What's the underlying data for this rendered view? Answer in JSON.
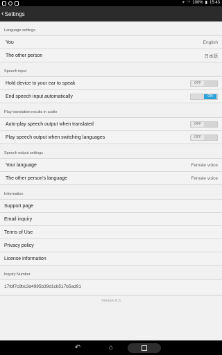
{
  "status_bar": {
    "battery": "100%",
    "time": "15:43"
  },
  "app_bar": {
    "title": "Settings"
  },
  "sections": {
    "language": {
      "header": "Language settings",
      "you_label": "You",
      "you_value": "English",
      "other_label": "The other person",
      "other_value": "日本語"
    },
    "speech_input": {
      "header": "Speech input",
      "hold_label": "Hold device to your ear to speak",
      "hold_toggle": "OFF",
      "end_label": "End speech input automatically",
      "end_toggle": "ON"
    },
    "audio": {
      "header": "Play translation results in audio",
      "autoplay_label": "Auto-play speech output when translated",
      "autoplay_toggle": "OFF",
      "switching_label": "Play speech output when switching languages",
      "switching_toggle": "OFF"
    },
    "speech_output": {
      "header": "Speech output settings",
      "your_label": "Your language",
      "your_value": "Female voice",
      "other_label": "The other person's language",
      "other_value": "Female voice"
    },
    "information": {
      "header": "Information",
      "items": [
        "Support page",
        "Email inquiry",
        "Terms of Use",
        "Privacy policy",
        "License information"
      ]
    },
    "inquiry": {
      "header": "Inquiry Number",
      "value": "17fdf7c9bc3d4995b39d1cb517b5ad91"
    }
  },
  "version": "Version 6.5",
  "icons": {
    "back": "chevron-left-icon",
    "nav_back": "back-arrow-icon",
    "nav_home": "home-icon",
    "nav_recent": "recent-apps-icon"
  },
  "colors": {
    "app_bar": "#2b2b2b",
    "toggle_on": "#2aa1d8",
    "background": "#f1f1f1"
  }
}
